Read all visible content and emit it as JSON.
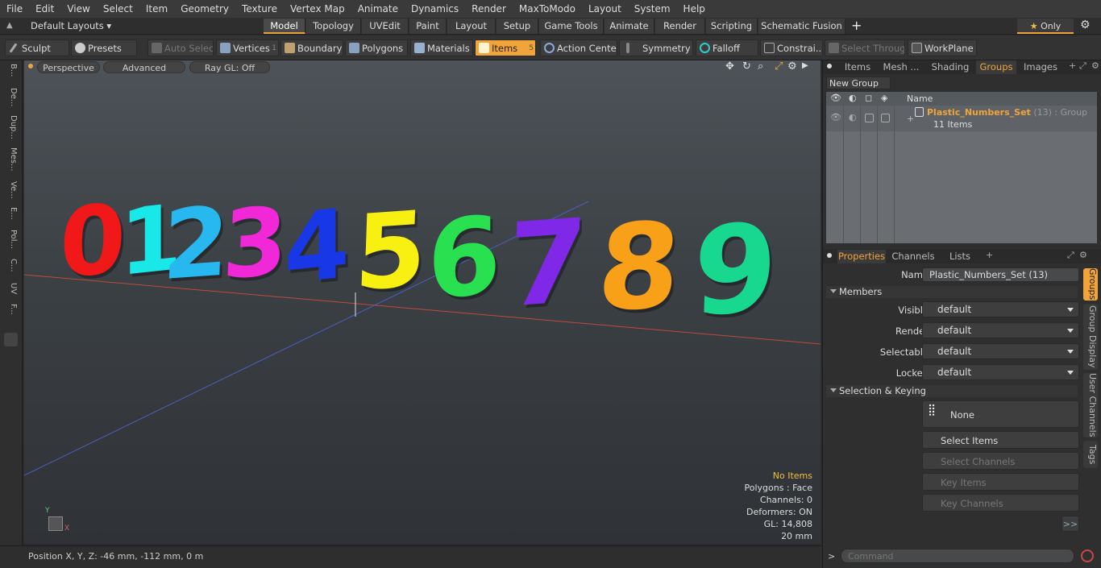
{
  "menu": [
    "File",
    "Edit",
    "View",
    "Select",
    "Item",
    "Geometry",
    "Texture",
    "Vertex Map",
    "Animate",
    "Dynamics",
    "Render",
    "MaxToModo",
    "Layout",
    "System",
    "Help"
  ],
  "layout_selector": "Default Layouts",
  "tabs": [
    "Model",
    "Topology",
    "UVEdit",
    "Paint",
    "Layout",
    "Setup",
    "Game Tools",
    "Animate",
    "Render",
    "Scripting",
    "Schematic Fusion"
  ],
  "tabs_active": "Model",
  "tabs_add": "+",
  "only_label": "Only",
  "toolbar": {
    "sculpt": "Sculpt",
    "presets": "Presets",
    "auto_select": "Auto Select",
    "vertices": "Vertices",
    "vertices_count": "1",
    "boundary": "Boundary",
    "polygons": "Polygons",
    "materials": "Materials",
    "items": "Items",
    "items_count": "5",
    "action_center": "Action Center",
    "symmetry": "Symmetry",
    "falloff": "Falloff",
    "constraints": "Constrai...",
    "select_through": "Select Through",
    "workplane": "WorkPlane"
  },
  "left_tabs": [
    "B...",
    "De...",
    "Dup...",
    "Mes...",
    "Ve...",
    "E...",
    "Pol...",
    "C...",
    "UV",
    "F..."
  ],
  "viewport": {
    "perspective": "Perspective",
    "advanced": "Advanced",
    "raygl": "Ray GL: Off",
    "digits": [
      "0",
      "1",
      "2",
      "3",
      "4",
      "5",
      "6",
      "7",
      "8",
      "9"
    ],
    "digit_colors": [
      "#f01818",
      "#18e8e8",
      "#28b8f0",
      "#f028d8",
      "#1838e8",
      "#f8f010",
      "#28e050",
      "#8028e8",
      "#f8a018",
      "#18d890"
    ]
  },
  "hud": {
    "no_items": "No Items",
    "polygons": "Polygons : Face",
    "channels": "Channels: 0",
    "deformers": "Deformers: ON",
    "gl": "GL: 14,808",
    "scale": "20 mm"
  },
  "status": {
    "position": "Position X, Y, Z:  -46 mm, -112 mm, 0 m"
  },
  "right_tabs": [
    "Items",
    "Mesh ...",
    "Shading",
    "Groups",
    "Images"
  ],
  "right_tabs_active": "Groups",
  "groups": {
    "new_group": "New Group",
    "col_name": "Name",
    "group_name": "Plastic_Numbers_Set",
    "group_meta": "(13) : Group",
    "group_items": "11 Items"
  },
  "prop_tabs": [
    "Properties",
    "Channels",
    "Lists"
  ],
  "props": {
    "name_label": "Name",
    "name_value": "Plastic_Numbers_Set (13)",
    "members": "Members",
    "visible_label": "Visible",
    "visible_value": "default",
    "render_label": "Render",
    "render_value": "default",
    "selectable_label": "Selectable",
    "selectable_value": "default",
    "locked_label": "Locked",
    "locked_value": "default",
    "selection_keying": "Selection & Keying",
    "none": "None",
    "select_items": "Select Items",
    "select_channels": "Select Channels",
    "key_items": "Key Items",
    "key_channels": "Key Channels",
    "more": ">>"
  },
  "side_tabs": [
    "Groups",
    "Group Display",
    "User Channels",
    "Tags"
  ],
  "command_placeholder": "Command",
  "command_prompt": ">",
  "accent": "#f0a43a"
}
